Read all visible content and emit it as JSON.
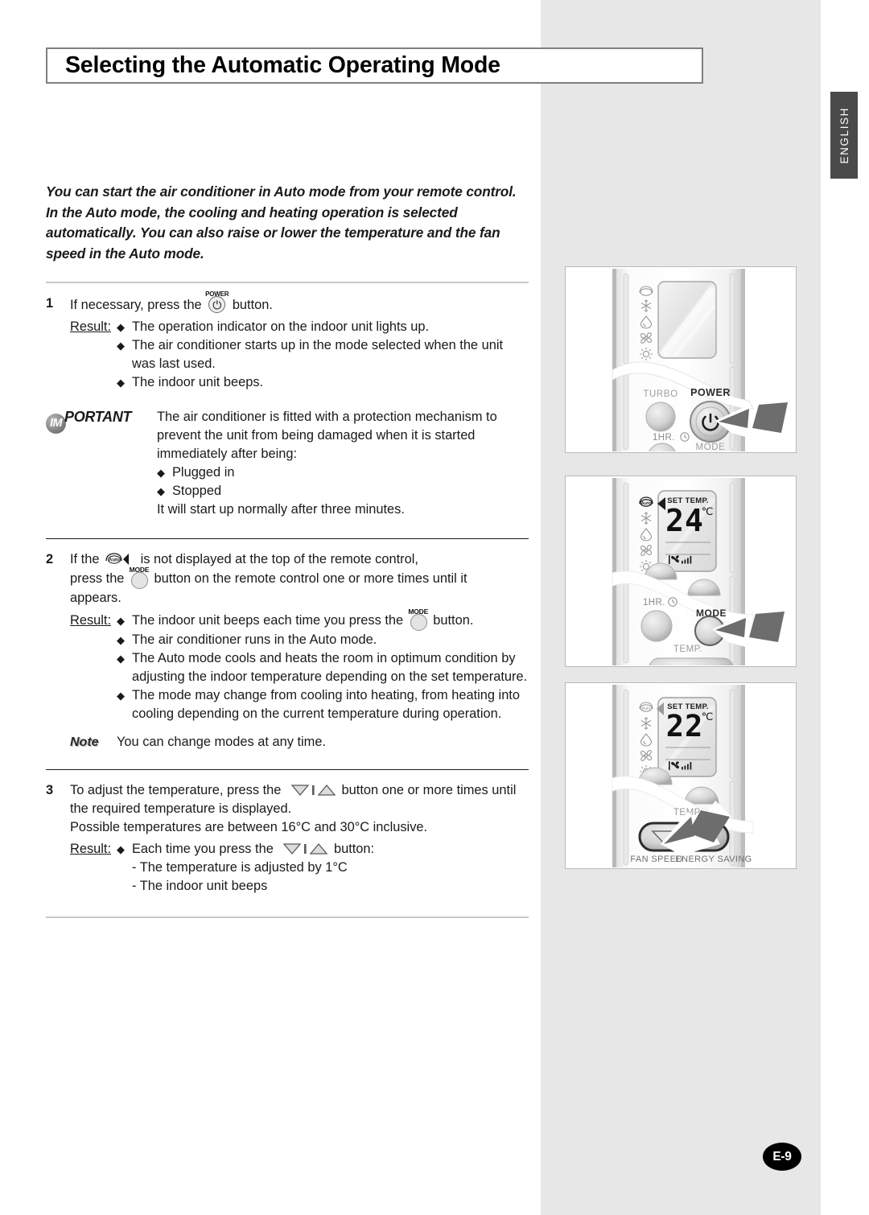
{
  "page": {
    "title": "Selecting the Automatic Operating Mode",
    "language_tab": "ENGLISH",
    "page_number": "E-9",
    "accent_gray": "#e7e7e7",
    "tab_color": "#4a4a4a"
  },
  "intro": "You can start the air conditioner in Auto mode from your remote control. In the Auto mode, the cooling and heating operation is selected automatically. You can also raise or lower the temperature and the fan speed in the Auto mode.",
  "steps": [
    {
      "number": "1",
      "text_before_icon": "If necessary, press the",
      "icon": "power-button-icon",
      "icon_label": "POWER",
      "text_after_icon": "button.",
      "result_label": "Result:",
      "results": [
        "The operation indicator on the indoor unit lights up.",
        "The air conditioner starts up in the mode selected when the unit was last used.",
        "The indoor unit beeps."
      ]
    }
  ],
  "important": {
    "tag_circle": "IM",
    "tag_rest": "PORTANT",
    "body_1": "The air conditioner is fitted with a protection mechanism to prevent the unit from being damaged when it is started immediately after being:",
    "bullets": [
      "Plugged in",
      "Stopped"
    ],
    "body_2": "It will start up normally after three minutes."
  },
  "step2": {
    "number": "2",
    "line1_a": "If the",
    "line1_icon": "auto-mode-indicator-icon",
    "line1_b": "is not displayed at the top of the remote control,",
    "line2_a": "press the",
    "line2_icon": "mode-button-icon",
    "line2_icon_label": "MODE",
    "line2_b": "button on the remote control one or more times until it",
    "line3": "appears.",
    "result_label": "Result:",
    "results": [
      {
        "text_a": "The indoor unit beeps each time you press the",
        "icon": "mode-button-icon",
        "icon_label": "MODE",
        "text_b": "button."
      },
      {
        "text_a": "The air conditioner runs in the Auto mode.",
        "icon": "",
        "icon_label": "",
        "text_b": ""
      },
      {
        "text_a": "The Auto mode cools and heats the room in optimum condition by adjusting the indoor temperature depending on the set temperature.",
        "icon": "",
        "icon_label": "",
        "text_b": ""
      },
      {
        "text_a": "The mode may change from cooling into heating, from heating into cooling depending on the current temperature during operation.",
        "icon": "",
        "icon_label": "",
        "text_b": ""
      }
    ]
  },
  "note": {
    "label": "Note",
    "text": "You can change modes at any time."
  },
  "step3": {
    "number": "3",
    "line1_a": "To adjust the temperature, press the",
    "line1_icon": "temp-down-up-buttons-icon",
    "line1_b": "button one or more times until",
    "line2": "the required temperature is displayed.",
    "line3": "Possible temperatures are between 16°C and 30°C inclusive.",
    "result_label": "Result:",
    "result_a": "Each time you press the",
    "result_icon": "temp-down-up-buttons-icon",
    "result_b": "button:",
    "sub_results": [
      "- The temperature is adjusted by 1°C",
      "- The indoor unit beeps"
    ]
  },
  "illustrations": [
    {
      "id": "panel-1",
      "name": "remote-power-button-illustration",
      "mode_icons": [
        "auto-icon",
        "snowflake-icon",
        "droplet-icon",
        "fan-icon",
        "sun-icon"
      ],
      "labels": [
        "TURBO",
        "POWER",
        "1HR.",
        "MODE"
      ],
      "display_text": "",
      "pressed_button": "POWER"
    },
    {
      "id": "panel-2",
      "name": "remote-mode-button-illustration",
      "mode_icons": [
        "auto-icon",
        "snowflake-icon",
        "droplet-icon",
        "fan-icon",
        "sun-icon"
      ],
      "labels": [
        "1HR.",
        "MODE",
        "TEMP."
      ],
      "display_heading": "SET TEMP.",
      "display_value": "24",
      "display_unit": "℃",
      "pressed_button": "MODE"
    },
    {
      "id": "panel-3",
      "name": "remote-temp-buttons-illustration",
      "mode_icons": [
        "auto-icon",
        "snowflake-icon",
        "droplet-icon",
        "fan-icon",
        "sun-icon"
      ],
      "labels": [
        "TEMP.",
        "FAN SPEED",
        "ENERGY SAVING"
      ],
      "display_heading": "SET TEMP.",
      "display_value": "22",
      "display_unit": "℃",
      "pressed_button": "TEMP down/up"
    }
  ]
}
